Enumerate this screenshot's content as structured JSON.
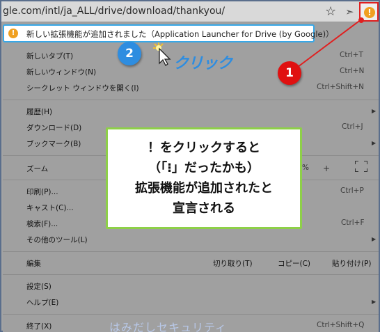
{
  "address_bar": {
    "url": "gle.com/intl/ja_ALL/drive/download/thankyou/",
    "icons": [
      "star-icon",
      "extension-icon",
      "alert-icon"
    ],
    "alert_glyph": "!"
  },
  "notification": {
    "glyph": "!",
    "text": "新しい拡張機能が追加されました（Application Launcher for Drive (by Google)）"
  },
  "menu": {
    "new_tab": {
      "label": "新しいタブ(T)",
      "shortcut": "Ctrl+T"
    },
    "new_window": {
      "label": "新しいウィンドウ(N)",
      "shortcut": "Ctrl+N"
    },
    "incognito": {
      "label": "シークレット ウィンドウを開く(I)",
      "shortcut": "Ctrl+Shift+N"
    },
    "history": {
      "label": "履歴(H)"
    },
    "downloads": {
      "label": "ダウンロード(D)",
      "shortcut": "Ctrl+J"
    },
    "bookmarks": {
      "label": "ブックマーク(B)"
    },
    "zoom": {
      "label": "ズーム",
      "pct": "%",
      "plus": "+"
    },
    "print": {
      "label": "印刷(P)...",
      "shortcut": "Ctrl+P"
    },
    "cast": {
      "label": "キャスト(C)..."
    },
    "find": {
      "label": "検索(F)...",
      "shortcut": "Ctrl+F"
    },
    "more_tools": {
      "label": "その他のツール(L)"
    },
    "edit": {
      "label": "編集",
      "cut": "切り取り(T)",
      "copy": "コピー(C)",
      "paste": "貼り付け(P)"
    },
    "settings": {
      "label": "設定(S)"
    },
    "help": {
      "label": "ヘルプ(E)"
    },
    "exit": {
      "label": "終了(X)",
      "shortcut": "Ctrl+Shift+Q"
    }
  },
  "annotations": {
    "badge_1": "1",
    "badge_2": "2",
    "click_label": "クリック",
    "callout_lines": [
      "！をクリックすると",
      "（「⁝」だったかも）",
      "拡張機能が追加されたと",
      "宣言される"
    ],
    "watermark": "はみだしセキュリティ"
  },
  "colors": {
    "alert_orange": "#f0a020",
    "highlight_red": "#e02020",
    "notification_border": "#38a8e8",
    "callout_border": "#8ed048",
    "badge_blue": "#2e8de0",
    "badge_red": "#e01010"
  }
}
